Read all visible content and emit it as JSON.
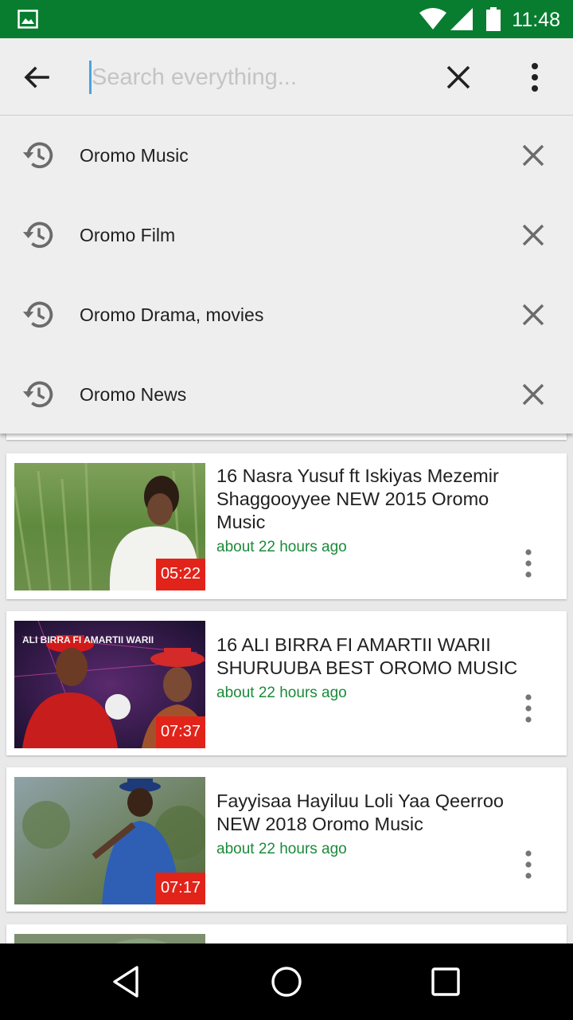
{
  "status_bar": {
    "time": "11:48",
    "icons": [
      "image-icon",
      "wifi-icon",
      "signal-icon",
      "battery-icon"
    ],
    "background": "#087d30"
  },
  "search": {
    "placeholder": "Search everything...",
    "value": ""
  },
  "suggestions": [
    {
      "label": "Oromo Music"
    },
    {
      "label": "Oromo Film"
    },
    {
      "label": "Oromo Drama, movies"
    },
    {
      "label": "Oromo News"
    }
  ],
  "videos": [
    {
      "title": "16 Nasra Yusuf ft Iskiyas Mezemir Shaggooyyee   NEW   2015 Oromo Music",
      "time": "about 22 hours ago",
      "duration": "05:22"
    },
    {
      "title": "16 ALI BIRRA FI AMARTII WARII SHURUUBA   BEST OROMO MUSIC",
      "time": "about 22 hours ago",
      "duration": "07:37",
      "thumb_caption": "ALI BIRRA FI AMARTII WARII"
    },
    {
      "title": "Fayyisaa Hayiluu  Loli Yaa Qeerroo NEW 2018 Oromo Music",
      "time": "about 22 hours ago",
      "duration": "07:17"
    }
  ],
  "colors": {
    "accent_green": "#1b8a3a",
    "duration_badge": "#e2231a",
    "cursor": "#4aa3df"
  }
}
